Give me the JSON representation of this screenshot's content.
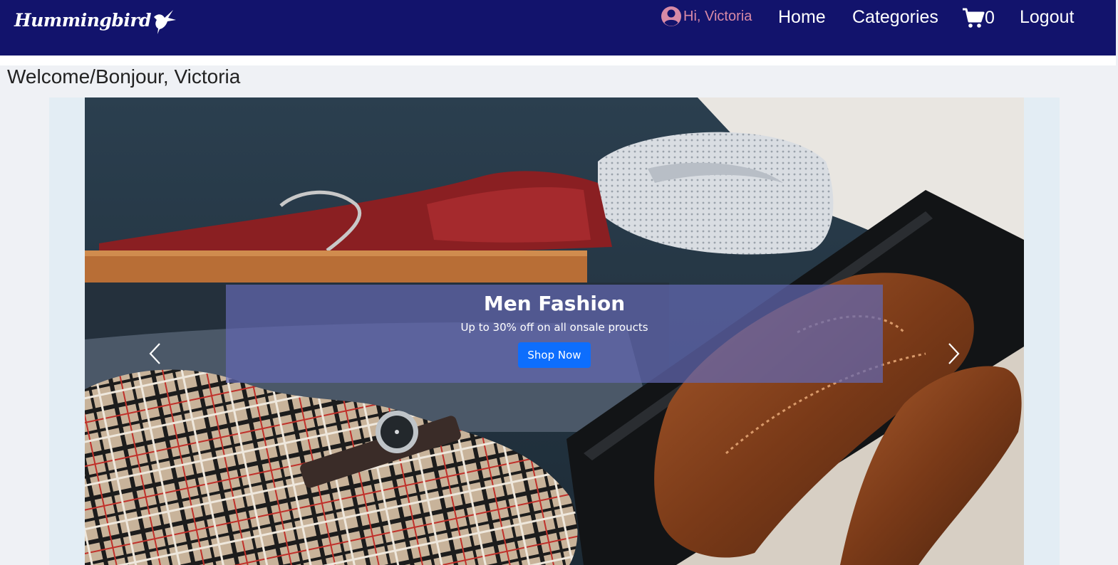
{
  "brand": {
    "name": "Hummingbird"
  },
  "nav": {
    "greeting": "Hi, Victoria",
    "home_label": "Home",
    "categories_label": "Categories",
    "cart_count": "0",
    "logout_label": "Logout"
  },
  "welcome_text": "Welcome/Bonjour, Victoria",
  "carousel": {
    "slide_title": "Men Fashion",
    "slide_subtitle": "Up to 30% off on all onsale proucts",
    "button_label": "Shop Now"
  },
  "colors": {
    "navbar": "#12136c",
    "greeting": "#d88aa6",
    "button": "#0d6efd"
  },
  "icons": [
    "hummingbird-logo-icon",
    "user-circle-icon",
    "cart-icon",
    "chevron-left-icon",
    "chevron-right-icon"
  ]
}
